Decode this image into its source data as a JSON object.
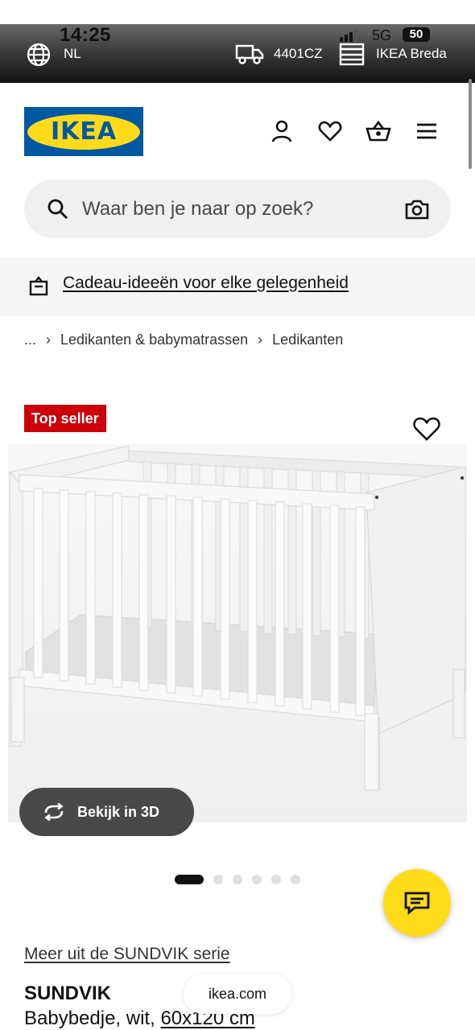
{
  "status_bar": {
    "time": "14:25",
    "network": "5G",
    "battery": "50",
    "language": "NL",
    "postcode": "4401CZ",
    "store": "IKEA Breda"
  },
  "header": {
    "logo_text": "IKEA",
    "brand_colors": {
      "blue": "#0058a3",
      "yellow": "#ffda1a"
    },
    "icons": [
      "user-icon",
      "heart-icon",
      "basket-icon",
      "menu-icon"
    ]
  },
  "search": {
    "placeholder": "Waar ben je naar op zoek?"
  },
  "promo": {
    "label": "Cadeau-ideeën voor elke gelegenheid"
  },
  "breadcrumb": {
    "items": [
      "...",
      "Ledikanten & babymatrassen",
      "Ledikanten"
    ]
  },
  "product": {
    "badge": "Top seller",
    "badge_color": "#cc0008",
    "view_3d_label": "Bekijk in 3D",
    "image_count": 6,
    "active_image": 1,
    "series_link": "Meer uit de SUNDVIK serie",
    "name": "SUNDVIK",
    "description": "Babybedje, wit, ",
    "dimensions": "60x120 cm"
  },
  "browser": {
    "url": "ikea.com"
  },
  "chat": {
    "color": "#ffdb1a"
  }
}
